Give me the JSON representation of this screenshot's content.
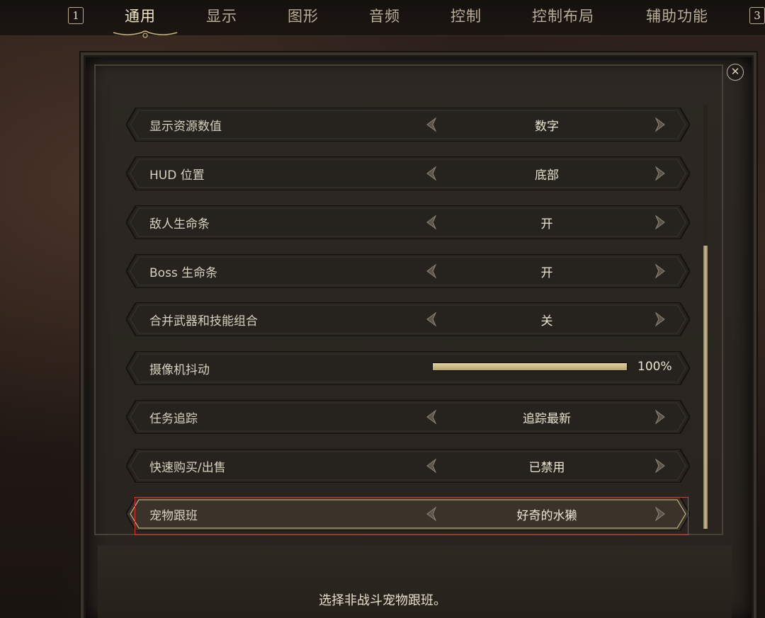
{
  "nav": {
    "prev_key": "1",
    "next_key": "3",
    "tabs": [
      {
        "label": "通用",
        "active": true
      },
      {
        "label": "显示"
      },
      {
        "label": "图形"
      },
      {
        "label": "音频"
      },
      {
        "label": "控制"
      },
      {
        "label": "控制布局"
      },
      {
        "label": "辅助功能"
      }
    ]
  },
  "settings": [
    {
      "label": "显示资源数值",
      "value": "数字"
    },
    {
      "label": "HUD 位置",
      "value": "底部"
    },
    {
      "label": "敌人生命条",
      "value": "开"
    },
    {
      "label": "Boss 生命条",
      "value": "开"
    },
    {
      "label": "合并武器和技能组合",
      "value": "关"
    },
    {
      "label": "摄像机抖动",
      "value": "100%",
      "slider_fraction": 1.0
    },
    {
      "label": "任务追踪",
      "value": "追踪最新"
    },
    {
      "label": "快速购买/出售",
      "value": "已禁用"
    },
    {
      "label": "宠物跟班",
      "value": "好奇的水獭",
      "selected": true
    }
  ],
  "description": "选择非战斗宠物跟班。",
  "colors": {
    "accent_gold": "#d8c98f",
    "selection_outline": "#e5322e",
    "text": "#d8d0c0"
  },
  "icons": {
    "close": "close-icon",
    "arrow_left": "arrow-left-icon",
    "arrow_right": "arrow-right-icon"
  }
}
